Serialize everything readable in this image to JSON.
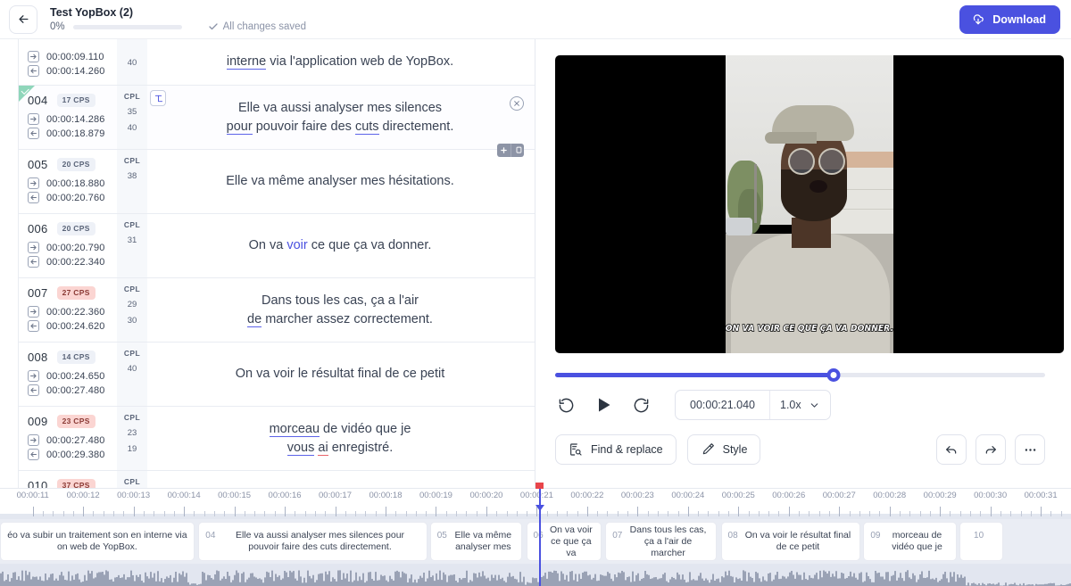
{
  "header": {
    "back_icon": "arrow-left-icon",
    "project_title": "Test YopBox (2)",
    "progress_percent": "0%",
    "saved_status": "All changes saved",
    "check_icon": "check-icon",
    "download_label": "Download",
    "download_icon": "cloud-download-icon",
    "accent_color": "#4a51e0"
  },
  "subtitles": {
    "cpl_header": "CPL",
    "rows": [
      {
        "seq": "",
        "cps": "",
        "start": "00:00:09.110",
        "end": "00:00:14.260",
        "cpl": [
          "40"
        ],
        "text_html": "<span class=\"u\">interne</span> via l'application web de YopBox.",
        "partial_top": true,
        "selected": false,
        "warn": false
      },
      {
        "seq": "004",
        "cps": "17 CPS",
        "start": "00:00:14.286",
        "end": "00:00:18.879",
        "cpl": [
          "35",
          "40"
        ],
        "text_html": "Elle va aussi analyser mes silences<br><span class=\"u\">pour</span> pouvoir faire des <span class=\"u\">cuts</span> directement.",
        "selected": true,
        "warn": false,
        "has_tool_chip": true,
        "has_close": true,
        "has_actions": true
      },
      {
        "seq": "005",
        "cps": "20 CPS",
        "start": "00:00:18.880",
        "end": "00:00:20.760",
        "cpl": [
          "38"
        ],
        "text_html": "Elle va m&ecirc;me analyser mes h&eacute;sitations.",
        "selected": false,
        "warn": false
      },
      {
        "seq": "006",
        "cps": "20 CPS",
        "start": "00:00:20.790",
        "end": "00:00:22.340",
        "cpl": [
          "31"
        ],
        "text_html": "On va <span class=\"hl\">voir</span> ce que &ccedil;a va donner.",
        "selected": false,
        "warn": false
      },
      {
        "seq": "007",
        "cps": "27 CPS",
        "start": "00:00:22.360",
        "end": "00:00:24.620",
        "cpl": [
          "29",
          "30"
        ],
        "text_html": "Dans tous les cas, &ccedil;a a l'air<br><span class=\"u\">de</span> marcher assez correctement.",
        "selected": false,
        "warn": true
      },
      {
        "seq": "008",
        "cps": "14 CPS",
        "start": "00:00:24.650",
        "end": "00:00:27.480",
        "cpl": [
          "40"
        ],
        "text_html": "On va voir le r&eacute;sultat final de ce petit",
        "selected": false,
        "warn": false
      },
      {
        "seq": "009",
        "cps": "23 CPS",
        "start": "00:00:27.480",
        "end": "00:00:29.380",
        "cpl": [
          "23",
          "19"
        ],
        "text_html": "<span class=\"u\">morceau</span> de vid&eacute;o que je<br><span class=\"u\">vous</span> <span class=\"u-red\">ai</span> enregistr&eacute;.",
        "selected": false,
        "warn": true
      },
      {
        "seq": "010",
        "cps": "37 CPS",
        "start": "",
        "end": "",
        "cpl": [],
        "text_html": "",
        "partial_bottom": true,
        "selected": false,
        "warn": true
      }
    ]
  },
  "player": {
    "caption_overlay": "ON VA VOIR CE QUE ÇA VA DONNER.",
    "current_time": "00:00:21.040",
    "playback_speed": "1.0x",
    "seek_percent": 56.8,
    "rewind_icon": "rewind-10-icon",
    "play_icon": "play-icon",
    "forward_icon": "forward-10-icon",
    "chevron_icon": "chevron-down-icon",
    "find_replace_label": "Find & replace",
    "find_replace_icon": "find-replace-icon",
    "style_label": "Style",
    "style_icon": "brush-icon",
    "undo_icon": "undo-icon",
    "redo_icon": "redo-icon",
    "more_icon": "more-horizontal-icon"
  },
  "timeline": {
    "playhead_time": "00:00:21.040",
    "ticks": [
      "00:00:11",
      "00:00:12",
      "00:00:13",
      "00:00:14",
      "00:00:15",
      "00:00:16",
      "00:00:17",
      "00:00:18",
      "00:00:19",
      "00:00:20",
      "00:00:21",
      "00:00:22",
      "00:00:23",
      "00:00:24",
      "00:00:25",
      "00:00:26",
      "00:00:27",
      "00:00:28",
      "00:00:29",
      "00:00:30",
      "00:00:31"
    ],
    "range_start_sec": 10.35,
    "range_end_sec": 31.6,
    "clips": [
      {
        "num": "",
        "text": "éo va subir un traitement son en interne via on web de YopBox.",
        "start": 10.35,
        "end": 14.26
      },
      {
        "num": "04",
        "text": "Elle va aussi analyser mes silences pour pouvoir faire des cuts directement.",
        "start": 14.286,
        "end": 18.879
      },
      {
        "num": "05",
        "text": "Elle va même analyser mes",
        "start": 18.88,
        "end": 20.76
      },
      {
        "num": "06",
        "text": "On va voir ce que ça va",
        "start": 20.79,
        "end": 22.34
      },
      {
        "num": "07",
        "text": "Dans tous les cas, ça a l'air de marcher",
        "start": 22.36,
        "end": 24.62
      },
      {
        "num": "08",
        "text": "On va voir le résultat final de ce petit",
        "start": 24.65,
        "end": 27.48
      },
      {
        "num": "09",
        "text": "morceau de vidéo que je",
        "start": 27.48,
        "end": 29.38
      },
      {
        "num": "10",
        "text": "",
        "start": 29.38,
        "end": 30.3
      }
    ]
  }
}
